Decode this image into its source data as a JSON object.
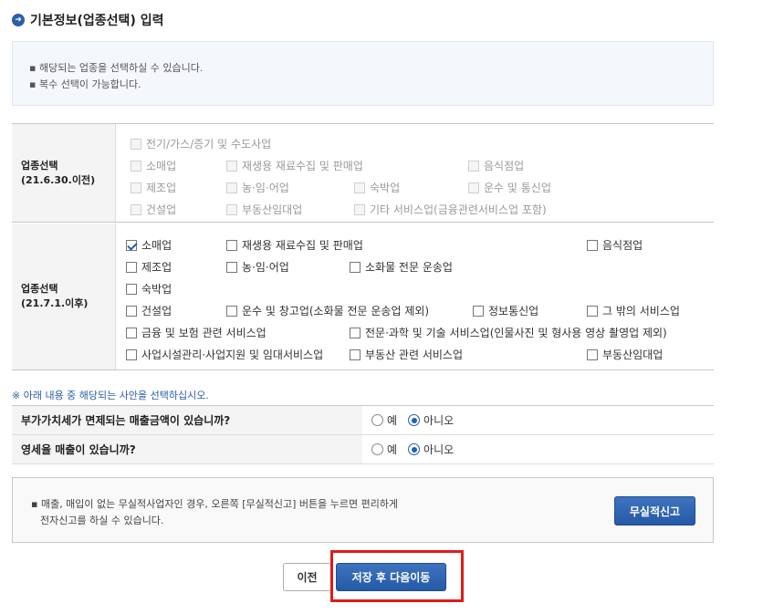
{
  "title": "기본정보(업종선택) 입력",
  "notice": [
    "해당되는 업종을 선택하실 수 있습니다.",
    "복수 선택이 가능합니다."
  ],
  "old_section": {
    "label_line1": "업종선택",
    "label_line2": "(21.6.30.이전)",
    "items": [
      "전기/가스/증기 및 수도사업",
      "소매업",
      "재생용 재료수집 및 판매업",
      "음식점업",
      "제조업",
      "농·임·어업",
      "숙박업",
      "운수 및 통신업",
      "건설업",
      "부동산임대업",
      "기타 서비스업(금융관련서비스업 포함)"
    ]
  },
  "new_section": {
    "label_line1": "업종선택",
    "label_line2": "(21.7.1.이후)",
    "items": [
      "소매업",
      "재생용 재료수집 및 판매업",
      "음식점업",
      "제조업",
      "농·임·어업",
      "소화물 전문 운송업",
      "숙박업",
      "건설업",
      "운수 및 창고업(소화물 전문 운송업 제외)",
      "정보통신업",
      "그 밖의 서비스업",
      "금융 및 보험 관련 서비스업",
      "전문·과학 및 기술 서비스업(인물사진 및 형사용 영상 촬영업 제외)",
      "사업시설관리·사업지원 및 임대서비스업",
      "부동산 관련 서비스업",
      "부동산임대업"
    ],
    "checked": [
      "소매업"
    ]
  },
  "note": "※ 아래 내용 중 해당되는 사안을 선택하십시오.",
  "questions": [
    {
      "q": "부가가치세가 면제되는 매출금액이 있습니까?",
      "yes": "예",
      "no": "아니오",
      "selected": "no"
    },
    {
      "q": "영세율 매출이 있습니까?",
      "yes": "예",
      "no": "아니오",
      "selected": "no"
    }
  ],
  "info": {
    "line1": "매출, 매입이 없는 무실적사업자인 경우, 오른쪽 [무실적신고] 버튼을 누르면 편리하게",
    "line2": "전자신고를 하실 수 있습니다.",
    "button": "무실적신고"
  },
  "buttons": {
    "prev": "이전",
    "next": "저장 후 다음이동"
  },
  "colors": {
    "accent": "#255aa6",
    "highlight": "#e11a1a"
  }
}
